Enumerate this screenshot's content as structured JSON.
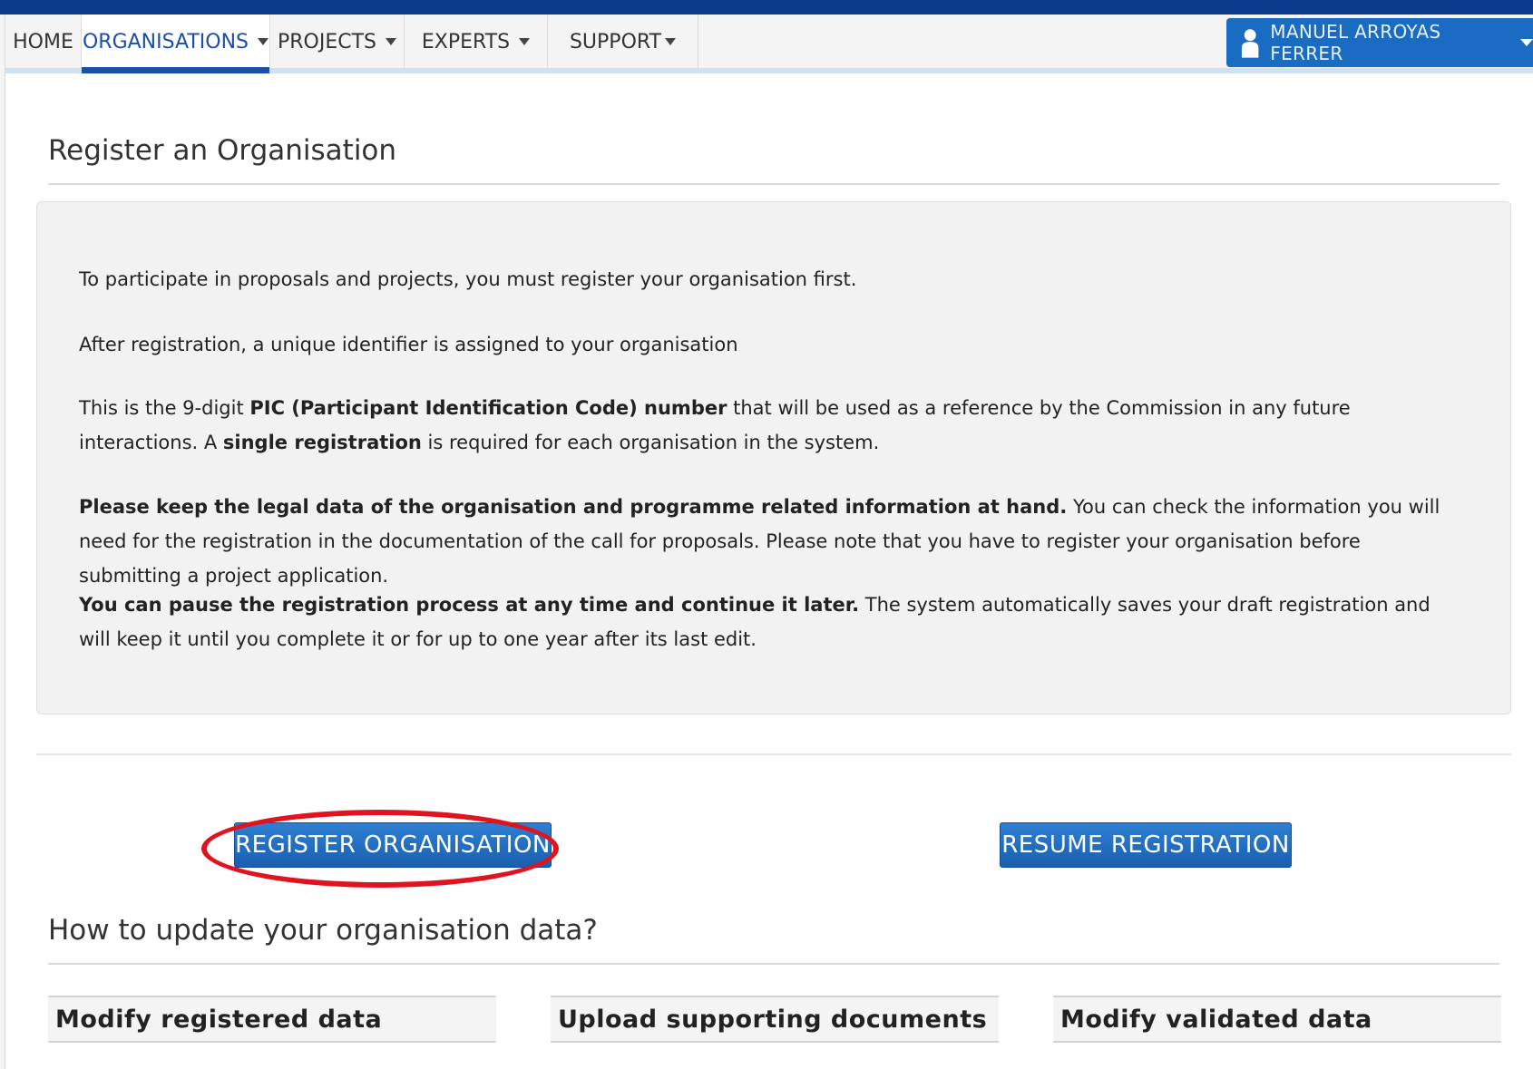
{
  "nav": {
    "items": [
      {
        "label": "HOME"
      },
      {
        "label": "ORGANISATIONS"
      },
      {
        "label": "PROJECTS"
      },
      {
        "label": "EXPERTS"
      },
      {
        "label": "SUPPORT"
      }
    ],
    "active": "ORGANISATIONS",
    "user": {
      "name": "MANUEL ARROYAS FERRER",
      "icon": "user-icon"
    }
  },
  "page": {
    "title": "Register an Organisation",
    "intro": {
      "p1": "To participate in proposals and projects, you must register your organisation first.",
      "p2": "After registration, a unique identifier is assigned to your organisation",
      "p3": {
        "a": "This is the 9-digit ",
        "b": "PIC (Participant Identification Code) number",
        "c": " that will be used as a reference by the Commission in any future interactions. A ",
        "d": "single registration",
        "e": " is required for each organisation in the system."
      },
      "p4": {
        "a": "Please keep the legal data of the organisation and programme related information at hand.",
        "b": " You can check the information you will need for the registration in the documentation of the call for proposals. Please note that you have to register your organisation before submitting a project application."
      },
      "p5": {
        "a": "You can pause the registration process at any time and continue it later.",
        "b": " The system automatically saves your draft registration and will keep it until you complete it or for up to one year after its last edit."
      }
    },
    "buttons": {
      "register": "REGISTER ORGANISATION",
      "resume": "RESUME REGISTRATION"
    },
    "update_title": "How to update your organisation data?",
    "cards": [
      {
        "label": "Modify registered data"
      },
      {
        "label": "Upload supporting documents"
      },
      {
        "label": "Modify validated data"
      }
    ]
  },
  "colors": {
    "nav_active": "#1b4fa8",
    "button": "#1a6bc2",
    "highlight": "#e0141e",
    "top_band": "#0b3b8c"
  }
}
